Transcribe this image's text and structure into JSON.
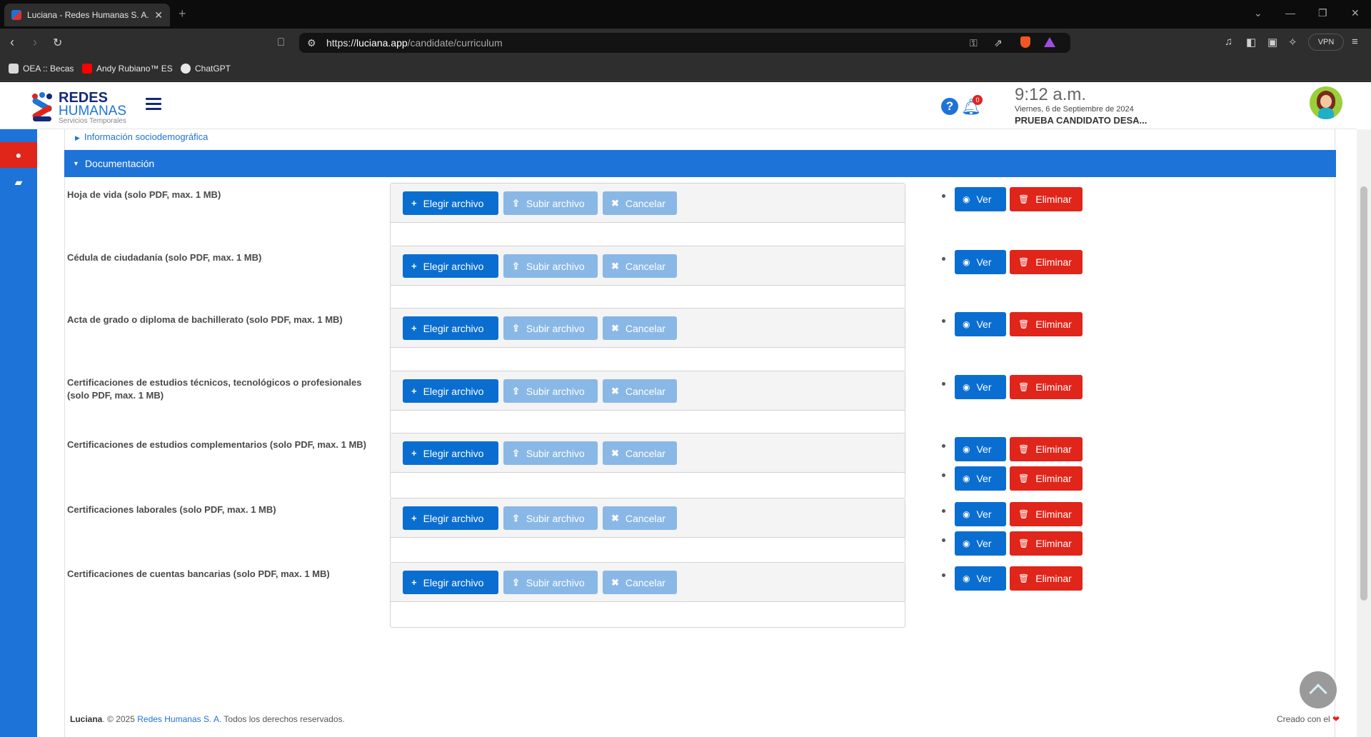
{
  "browser": {
    "tab_title": "Luciana - Redes Humanas S. A.",
    "tab_close": "✕",
    "new_tab": "+",
    "url_scheme": "https://",
    "url_host": "luciana.app",
    "url_path": "/candidate/curriculum",
    "vpn_label": "VPN",
    "bookmarks": [
      {
        "label": "OEA :: Becas",
        "color": "#d9d9d9"
      },
      {
        "label": "Andy Rubiano™ ES",
        "color": "#ff0000"
      },
      {
        "label": "ChatGPT",
        "color": "#e8e8e8"
      }
    ]
  },
  "app": {
    "logo_line1": "REDES",
    "logo_line2": "HUMANAS",
    "logo_line3": "Servicios Temporales",
    "help_label": "?",
    "notifications_count": "0",
    "time": "9:12 a.m.",
    "date": "Viernes, 6 de Septiembre de 2024",
    "user": "PRUEBA CANDIDATO DESA..."
  },
  "sections": {
    "socio": "Información sociodemográfica",
    "documentation": "Documentación"
  },
  "buttons": {
    "choose": "Elegir archivo",
    "upload": "Subir archivo",
    "cancel": "Cancelar",
    "view": "Ver",
    "delete": "Eliminar"
  },
  "documents": [
    {
      "label": "Hoja de vida (solo PDF, max. 1 MB)",
      "files": 1
    },
    {
      "label": "Cédula de ciudadanía (solo PDF, max. 1 MB)",
      "files": 1
    },
    {
      "label": "Acta de grado o diploma de bachillerato (solo PDF, max. 1 MB)",
      "files": 1
    },
    {
      "label": "Certificaciones de estudios técnicos, tecnológicos o profesionales (solo PDF, max. 1 MB)",
      "files": 1
    },
    {
      "label": "Certificaciones de estudios complementarios (solo PDF, max. 1 MB)",
      "files": 2
    },
    {
      "label": "Certificaciones laborales (solo PDF, max. 1 MB)",
      "files": 2
    },
    {
      "label": "Certificaciones de cuentas bancarias (solo PDF, max. 1 MB)",
      "files": 1
    }
  ],
  "footer": {
    "brand": "Luciana",
    "copyright": ". © 2025 ",
    "company": "Redes Humanas S. A.",
    "rights": " Todos los derechos reservados.",
    "created": "Creado con el ",
    "heart": "❤"
  }
}
